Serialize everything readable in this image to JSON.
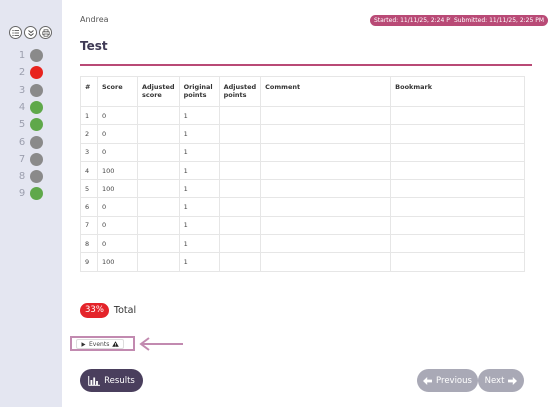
{
  "sidebar": {
    "tools": [
      {
        "icon": "list-icon"
      },
      {
        "icon": "collapse-icon"
      },
      {
        "icon": "print-icon"
      }
    ],
    "questions": [
      {
        "number": "1",
        "status_color": "#8a8a8a"
      },
      {
        "number": "2",
        "status_color": "#e8231e"
      },
      {
        "number": "3",
        "status_color": "#8a8a8a"
      },
      {
        "number": "4",
        "status_color": "#5fa84a"
      },
      {
        "number": "5",
        "status_color": "#5fa84a"
      },
      {
        "number": "6",
        "status_color": "#8a8a8a"
      },
      {
        "number": "7",
        "status_color": "#8a8a8a"
      },
      {
        "number": "8",
        "status_color": "#8a8a8a"
      },
      {
        "number": "9",
        "status_color": "#5fa84a"
      }
    ]
  },
  "header": {
    "user_name": "Andrea",
    "started": "Started: 11/11/25, 2:24 PM",
    "submitted": "Submitted: 11/11/25, 2:25 PM",
    "title": "Test"
  },
  "table": {
    "columns": [
      "#",
      "Score",
      "Adjusted score",
      "Original points",
      "Adjusted points",
      "Comment",
      "Bookmark"
    ],
    "rows": [
      {
        "num": "1",
        "score": "0",
        "adjusted_score": "",
        "original_points": "1",
        "adjusted_points": "",
        "comment": "",
        "bookmark": ""
      },
      {
        "num": "2",
        "score": "0",
        "adjusted_score": "",
        "original_points": "1",
        "adjusted_points": "",
        "comment": "",
        "bookmark": ""
      },
      {
        "num": "3",
        "score": "0",
        "adjusted_score": "",
        "original_points": "1",
        "adjusted_points": "",
        "comment": "",
        "bookmark": ""
      },
      {
        "num": "4",
        "score": "100",
        "adjusted_score": "",
        "original_points": "1",
        "adjusted_points": "",
        "comment": "",
        "bookmark": ""
      },
      {
        "num": "5",
        "score": "100",
        "adjusted_score": "",
        "original_points": "1",
        "adjusted_points": "",
        "comment": "",
        "bookmark": ""
      },
      {
        "num": "6",
        "score": "0",
        "adjusted_score": "",
        "original_points": "1",
        "adjusted_points": "",
        "comment": "",
        "bookmark": ""
      },
      {
        "num": "7",
        "score": "0",
        "adjusted_score": "",
        "original_points": "1",
        "adjusted_points": "",
        "comment": "",
        "bookmark": ""
      },
      {
        "num": "8",
        "score": "0",
        "adjusted_score": "",
        "original_points": "1",
        "adjusted_points": "",
        "comment": "",
        "bookmark": ""
      },
      {
        "num": "9",
        "score": "100",
        "adjusted_score": "",
        "original_points": "1",
        "adjusted_points": "",
        "comment": "",
        "bookmark": ""
      }
    ]
  },
  "total": {
    "percent": "33%",
    "label": "Total",
    "color": "#e4242a"
  },
  "events": {
    "label": "Events",
    "expand_icon": "triangle-right-icon",
    "warning_icon": "warning-icon"
  },
  "footer": {
    "results_label": "Results",
    "results_icon": "bar-chart-icon",
    "previous_label": "Previous",
    "next_label": "Next"
  },
  "colors": {
    "accent": "#b94a76",
    "dark_button": "#4a3f5d",
    "disabled_button": "#a9a9b6",
    "sidebar_bg": "#e4e6f1"
  }
}
